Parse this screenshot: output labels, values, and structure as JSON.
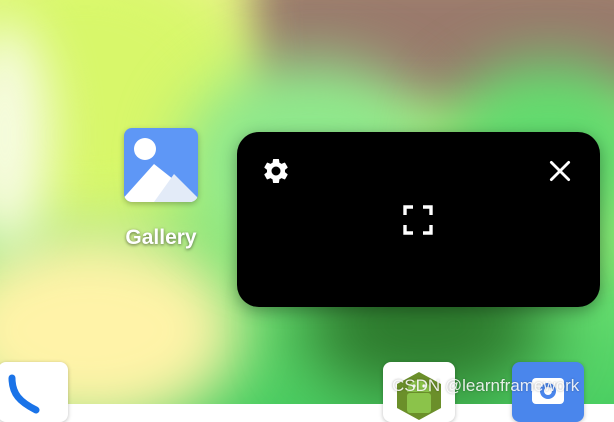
{
  "home_screen": {
    "apps": [
      {
        "label": "Gallery",
        "icon": "gallery-icon"
      }
    ],
    "dock": [
      {
        "icon": "phone-icon"
      },
      {
        "icon": "android-icon"
      },
      {
        "icon": "camera-icon"
      }
    ]
  },
  "pip_menu": {
    "actions": [
      {
        "id": "settings",
        "icon": "gear-icon"
      },
      {
        "id": "expand",
        "icon": "fullscreen-icon"
      },
      {
        "id": "close",
        "icon": "close-icon"
      }
    ]
  },
  "watermark": "CSDN @learnframework",
  "colors": {
    "pip_background": "#000000",
    "gallery_icon_bg": "#5e97f6",
    "camera_icon_bg": "#4a86ec",
    "phone_icon": "#1a73e8",
    "android_green": "#8bc34a"
  }
}
